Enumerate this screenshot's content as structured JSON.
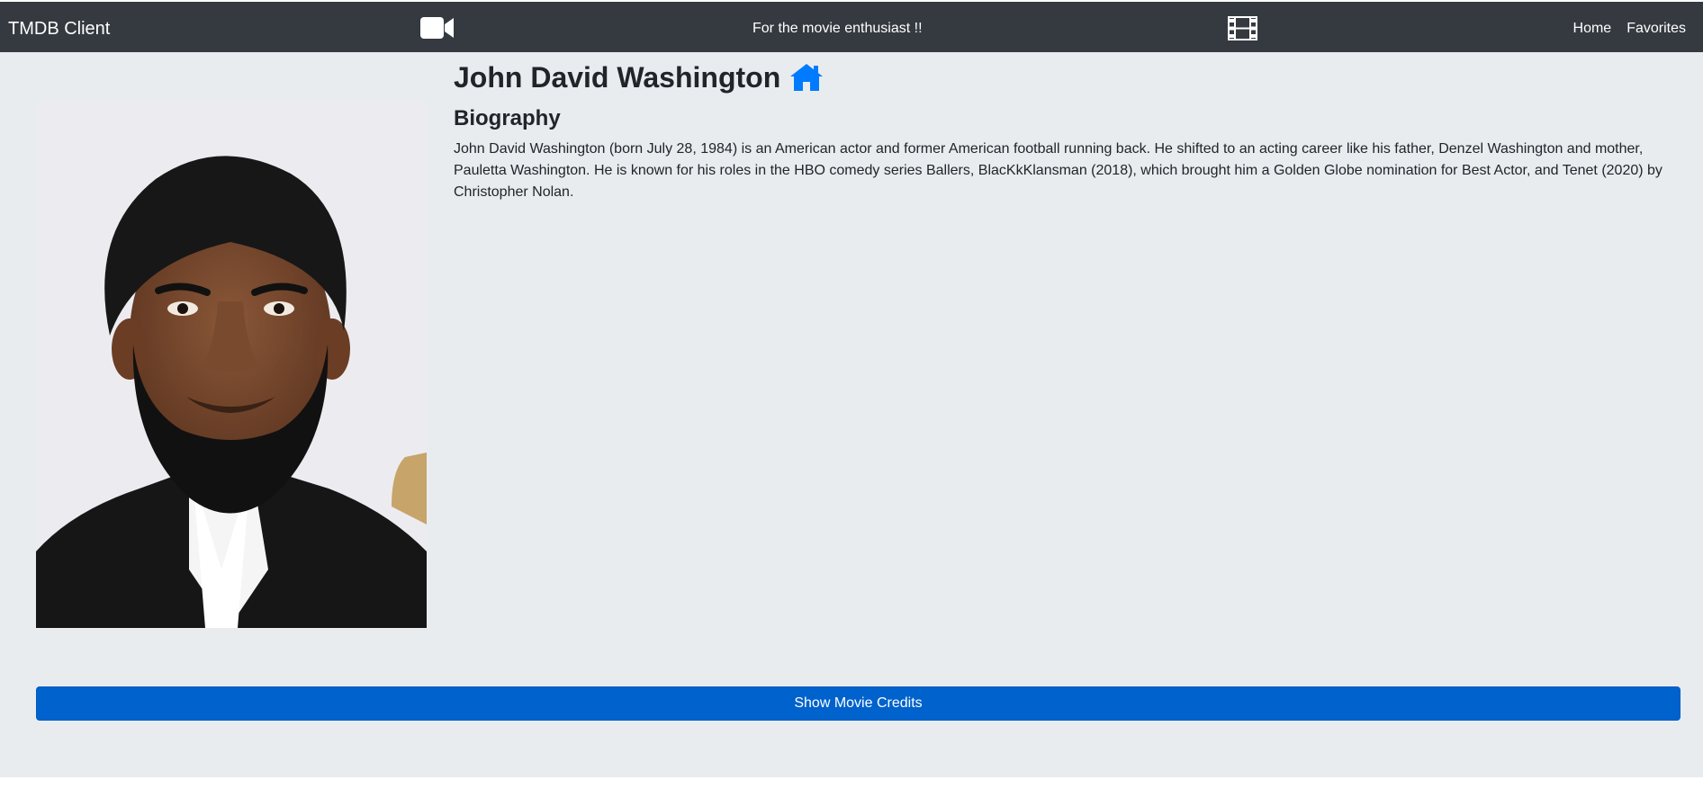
{
  "navbar": {
    "brand": "TMDB Client",
    "camera_icon": "video-camera-icon",
    "tagline": "For the movie enthusiast !!",
    "film_icon": "film-icon",
    "links": [
      "Home",
      "Favorites"
    ]
  },
  "person": {
    "name": "John David Washington",
    "home_icon": "home-icon",
    "photo_alt": "John David Washington",
    "biography_heading": "Biography",
    "biography": "John David Washington (born July 28, 1984) is an American actor and former American football running back. He shifted to an acting career like his father, Denzel Washington and mother, Pauletta Washington. He is known for his roles in the HBO comedy series Ballers, BlacKkKlansman (2018), which brought him a Golden Globe nomination for Best Actor, and Tenet (2020) by Christopher Nolan."
  },
  "actions": {
    "show_credits": "Show Movie Credits"
  },
  "colors": {
    "navbar": "#343a40",
    "content_background": "#e9ecef",
    "primary_button": "#0062cc",
    "home_icon": "#007bff"
  }
}
